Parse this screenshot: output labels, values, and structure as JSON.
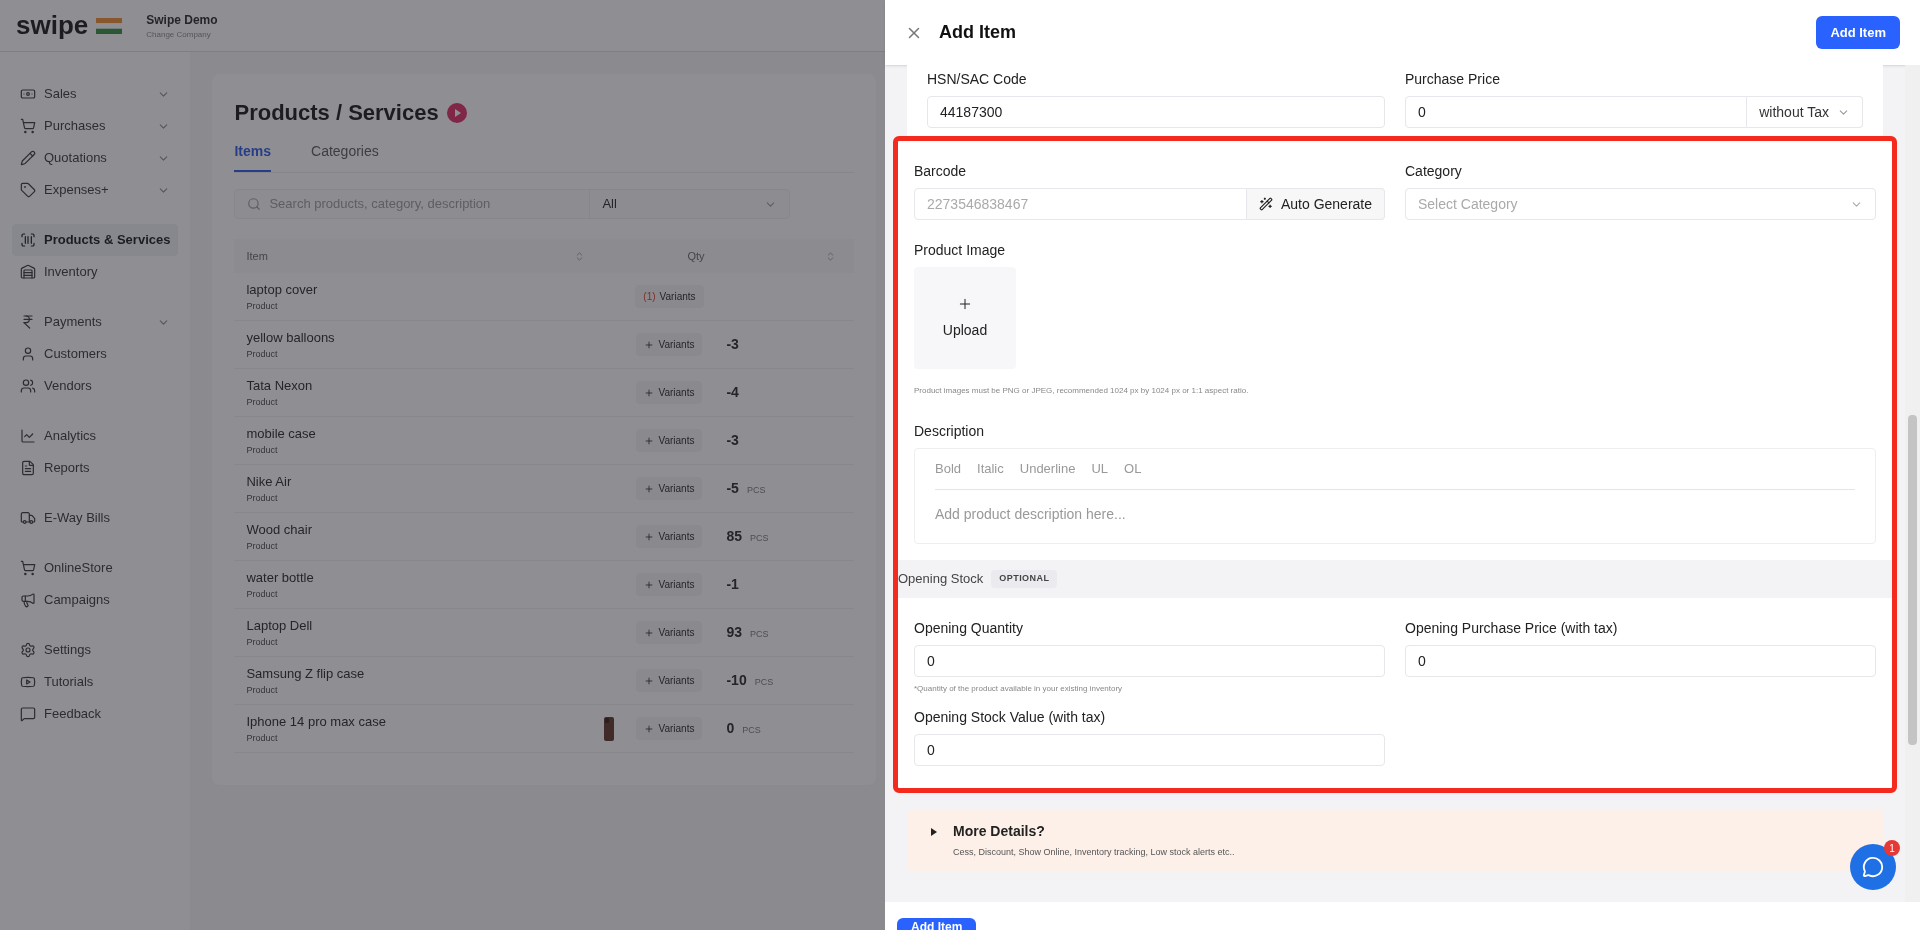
{
  "app": {
    "logo": "swipe",
    "company": "Swipe Demo",
    "company_action": "Change Company"
  },
  "sidebar": {
    "groups": [
      [
        {
          "label": "Sales",
          "expandable": true,
          "selected": false
        },
        {
          "label": "Purchases",
          "expandable": true,
          "selected": false
        },
        {
          "label": "Quotations",
          "expandable": true,
          "selected": false
        },
        {
          "label": "Expenses+",
          "expandable": true,
          "selected": false
        }
      ],
      [
        {
          "label": "Products & Services",
          "expandable": false,
          "selected": true
        },
        {
          "label": "Inventory",
          "expandable": false,
          "selected": false
        }
      ],
      [
        {
          "label": "Payments",
          "expandable": true,
          "selected": false
        },
        {
          "label": "Customers",
          "expandable": false,
          "selected": false
        },
        {
          "label": "Vendors",
          "expandable": false,
          "selected": false
        }
      ],
      [
        {
          "label": "Analytics",
          "expandable": false,
          "selected": false
        },
        {
          "label": "Reports",
          "expandable": false,
          "selected": false
        }
      ],
      [
        {
          "label": "E-Way Bills",
          "expandable": false,
          "selected": false
        }
      ],
      [
        {
          "label": "OnlineStore",
          "expandable": false,
          "selected": false
        },
        {
          "label": "Campaigns",
          "expandable": false,
          "selected": false
        }
      ],
      [
        {
          "label": "Settings",
          "expandable": false,
          "selected": false
        },
        {
          "label": "Tutorials",
          "expandable": false,
          "selected": false
        },
        {
          "label": "Feedback",
          "expandable": false,
          "selected": false
        }
      ]
    ]
  },
  "page": {
    "title": "Products / Services",
    "tabs": [
      {
        "label": "Items",
        "selected": true
      },
      {
        "label": "Categories",
        "selected": false
      }
    ],
    "search": {
      "placeholder": "Search products, category, description"
    },
    "filter": {
      "value": "All"
    },
    "table": {
      "columns": [
        "Item",
        "Qty"
      ],
      "rows": [
        {
          "name": "laptop cover",
          "type": "Product",
          "variants": "Variants",
          "variant_count": "(1)",
          "qty": "",
          "unit": "",
          "thumbnail": false
        },
        {
          "name": "yellow balloons",
          "type": "Product",
          "variants": "Variants",
          "qty": "-3",
          "unit": "",
          "thumbnail": false
        },
        {
          "name": "Tata Nexon",
          "type": "Product",
          "variants": "Variants",
          "qty": "-4",
          "unit": "",
          "thumbnail": false
        },
        {
          "name": "mobile case",
          "type": "Product",
          "variants": "Variants",
          "qty": "-3",
          "unit": "",
          "thumbnail": false
        },
        {
          "name": "Nike Air",
          "type": "Product",
          "variants": "Variants",
          "qty": "-5",
          "unit": "PCS",
          "thumbnail": false
        },
        {
          "name": "Wood chair",
          "type": "Product",
          "variants": "Variants",
          "qty": "85",
          "unit": "PCS",
          "thumbnail": false
        },
        {
          "name": "water bottle",
          "type": "Product",
          "variants": "Variants",
          "qty": "-1",
          "unit": "",
          "thumbnail": false
        },
        {
          "name": "Laptop Dell",
          "type": "Product",
          "variants": "Variants",
          "qty": "93",
          "unit": "PCS",
          "thumbnail": false
        },
        {
          "name": "Samsung Z flip case",
          "type": "Product",
          "variants": "Variants",
          "qty": "-10",
          "unit": "PCS",
          "thumbnail": false
        },
        {
          "name": "Iphone 14 pro max case",
          "type": "Product",
          "variants": "Variants",
          "qty": "0",
          "unit": "PCS",
          "thumbnail": true
        }
      ]
    }
  },
  "drawer": {
    "title": "Add Item",
    "primary_button": "Add Item",
    "hsn": {
      "label": "HSN/SAC Code",
      "value": "44187300"
    },
    "purchase_price": {
      "label": "Purchase Price",
      "value": "0",
      "tax_mode": "without Tax"
    },
    "highlighted": true,
    "barcode": {
      "label": "Barcode",
      "placeholder": "2273546838467",
      "action": "Auto Generate"
    },
    "category": {
      "label": "Category",
      "placeholder": "Select Category"
    },
    "image": {
      "label": "Product Image",
      "upload": "Upload",
      "hint": "Product images must be PNG or JPEG, recommended 1024 px by 1024 px or 1:1 aspect ratio."
    },
    "description": {
      "label": "Description",
      "toolbar": [
        "Bold",
        "Italic",
        "Underline",
        "UL",
        "OL"
      ],
      "placeholder": "Add product description here..."
    },
    "opening_stock": {
      "title": "Opening Stock",
      "badge": "OPTIONAL",
      "quantity": {
        "label": "Opening Quantity",
        "value": "0",
        "hint": "*Quantity of the product available in your existing inventory"
      },
      "price": {
        "label": "Opening Purchase Price (with tax)",
        "value": "0"
      },
      "value": {
        "label": "Opening Stock Value (with tax)",
        "value": "0"
      }
    },
    "more": {
      "title": "More Details?",
      "subtitle": "Cess, Discount, Show Online, Inventory tracking, Low stock alerts etc.."
    },
    "footer_button": "Add Item",
    "chat_badge": "1"
  }
}
